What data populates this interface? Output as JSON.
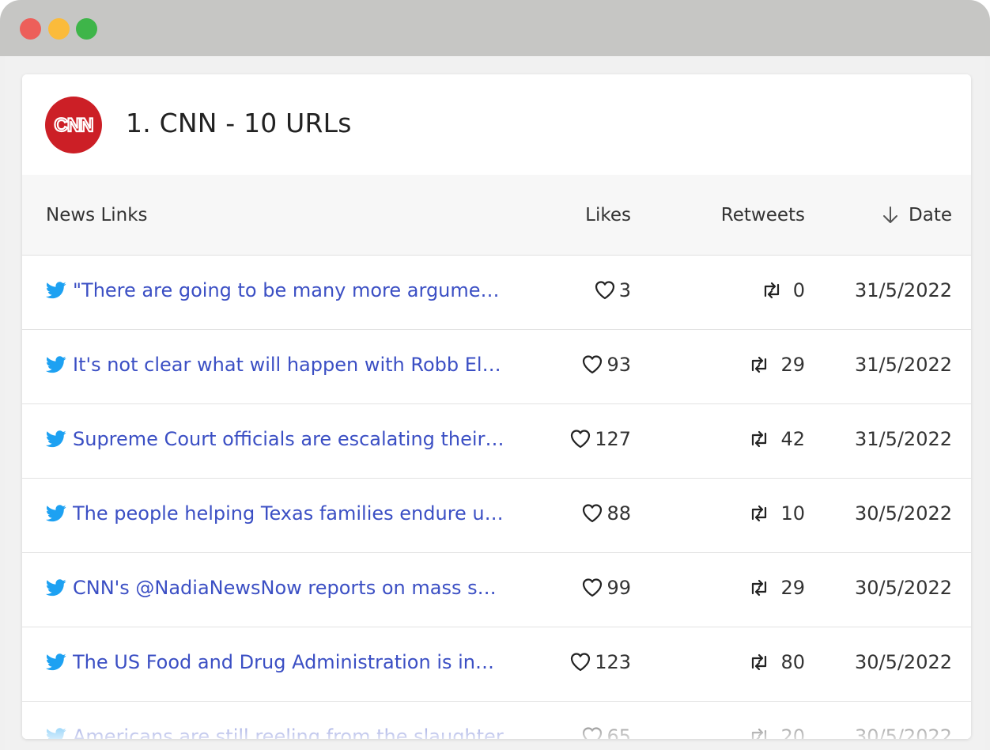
{
  "card": {
    "logo_text": "CNN",
    "title": "1. CNN - 10 URLs"
  },
  "table": {
    "headers": {
      "links": "News Links",
      "likes": "Likes",
      "retweets": "Retweets",
      "date": "Date",
      "date_sort_icon": "arrow-down-icon"
    },
    "rows": [
      {
        "text": "\"There are going to be many more arguments about this in the coming months\"",
        "likes": "3",
        "retweets": "0",
        "date": "31/5/2022"
      },
      {
        "text": "It's not clear what will happen with Robb Elementary School in the coming months",
        "likes": "93",
        "retweets": "29",
        "date": "31/5/2022"
      },
      {
        "text": "Supreme Court officials are escalating their investigation into the leak",
        "likes": "127",
        "retweets": "42",
        "date": "31/5/2022"
      },
      {
        "text": "The people helping Texas families endure unspeakable grief",
        "likes": "88",
        "retweets": "10",
        "date": "30/5/2022"
      },
      {
        "text": "CNN's @NadiaNewsNow reports on mass shootings",
        "likes": "99",
        "retweets": "29",
        "date": "30/5/2022"
      },
      {
        "text": "The US Food and Drug Administration is investigating",
        "likes": "123",
        "retweets": "80",
        "date": "30/5/2022"
      },
      {
        "text": "Americans are still reeling from the slaughter",
        "likes": "65",
        "retweets": "20",
        "date": "30/5/2022"
      }
    ]
  },
  "colors": {
    "link": "#3b4fc4",
    "brand": "#cc1f26",
    "twitter": "#1da1f2"
  }
}
